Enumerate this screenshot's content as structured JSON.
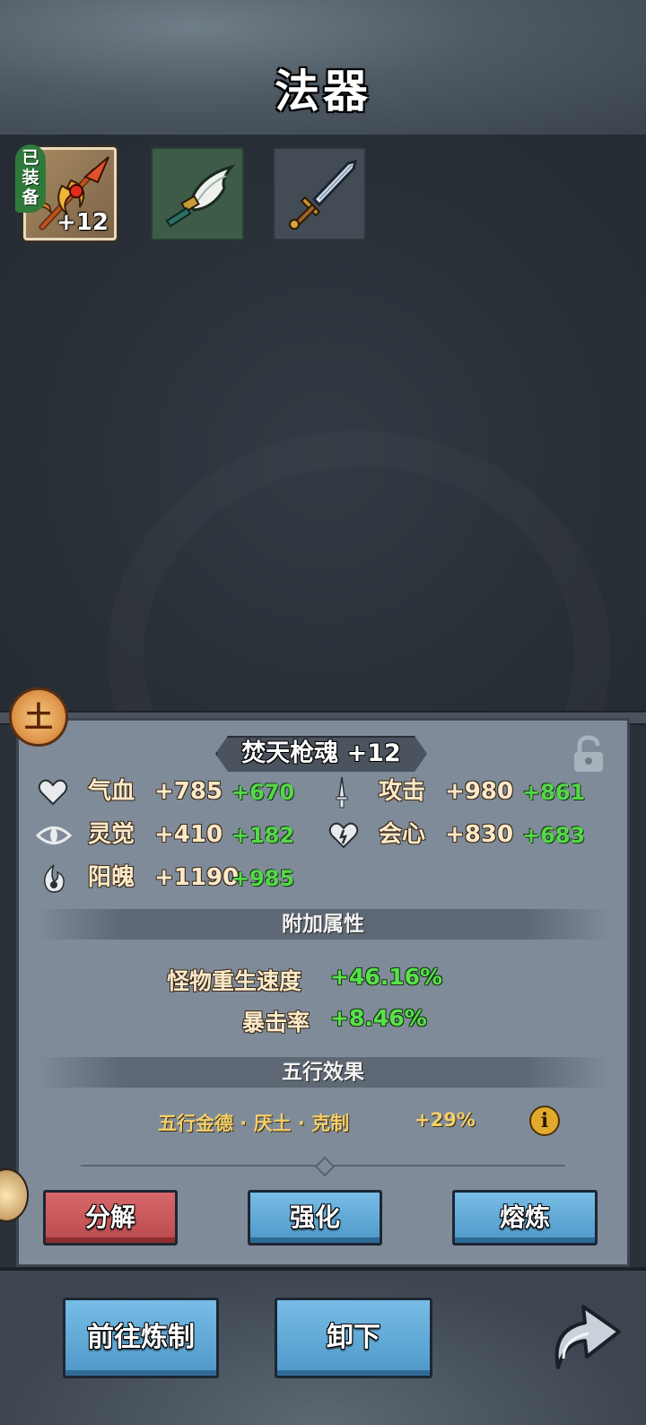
{
  "header": {
    "title": "法器"
  },
  "slots": {
    "equipped_tag": "已装备",
    "equipped_level": "+12"
  },
  "detail": {
    "element": "土",
    "name": "焚天枪魂 +12",
    "stats": [
      {
        "label": "气血",
        "value": "+785",
        "bonus": "+670"
      },
      {
        "label": "攻击",
        "value": "+980",
        "bonus": "+861"
      },
      {
        "label": "灵觉",
        "value": "+410",
        "bonus": "+182"
      },
      {
        "label": "会心",
        "value": "+830",
        "bonus": "+683"
      },
      {
        "label": "阳魄",
        "value": "+1190",
        "bonus": "+985"
      }
    ],
    "extra_title": "附加属性",
    "extra_attrs": [
      {
        "label": "怪物重生速度",
        "value": "+46.16%"
      },
      {
        "label": "暴击率",
        "value": "+8.46%"
      }
    ],
    "wuxing_title": "五行效果",
    "wuxing_text": "五行金德 · 厌土 · 克制",
    "wuxing_value": "+29%",
    "info_symbol": "i"
  },
  "actions": {
    "decompose": "分解",
    "enhance": "强化",
    "smelt": "熔炼",
    "goto_forge": "前往炼制",
    "unequip": "卸下"
  },
  "colors": {
    "accent_green": "#57d64a",
    "stat_text": "#fbe9c8",
    "red_button": "#c9585b",
    "blue_button": "#5ea8d8"
  }
}
